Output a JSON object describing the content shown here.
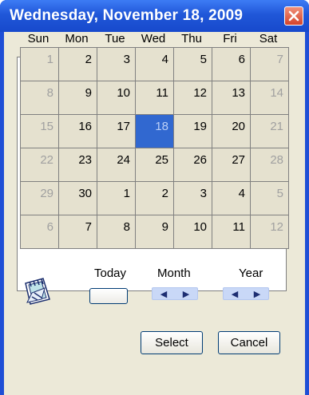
{
  "window": {
    "title": "Wednesday, November 18, 2009"
  },
  "calendar": {
    "weekdays": [
      "Sun",
      "Mon",
      "Tue",
      "Wed",
      "Thu",
      "Fri",
      "Sat"
    ],
    "weeks": [
      [
        "1",
        "2",
        "3",
        "4",
        "5",
        "6",
        "7"
      ],
      [
        "8",
        "9",
        "10",
        "11",
        "12",
        "13",
        "14"
      ],
      [
        "15",
        "16",
        "17",
        "18",
        "19",
        "20",
        "21"
      ],
      [
        "22",
        "23",
        "24",
        "25",
        "26",
        "27",
        "28"
      ],
      [
        "29",
        "30",
        "1",
        "2",
        "3",
        "4",
        "5"
      ],
      [
        "6",
        "7",
        "8",
        "9",
        "10",
        "11",
        "12"
      ]
    ],
    "selected_day": "18"
  },
  "controls": {
    "today_label": "Today",
    "month_label": "Month",
    "year_label": "Year"
  },
  "buttons": {
    "select": "Select",
    "cancel": "Cancel"
  }
}
